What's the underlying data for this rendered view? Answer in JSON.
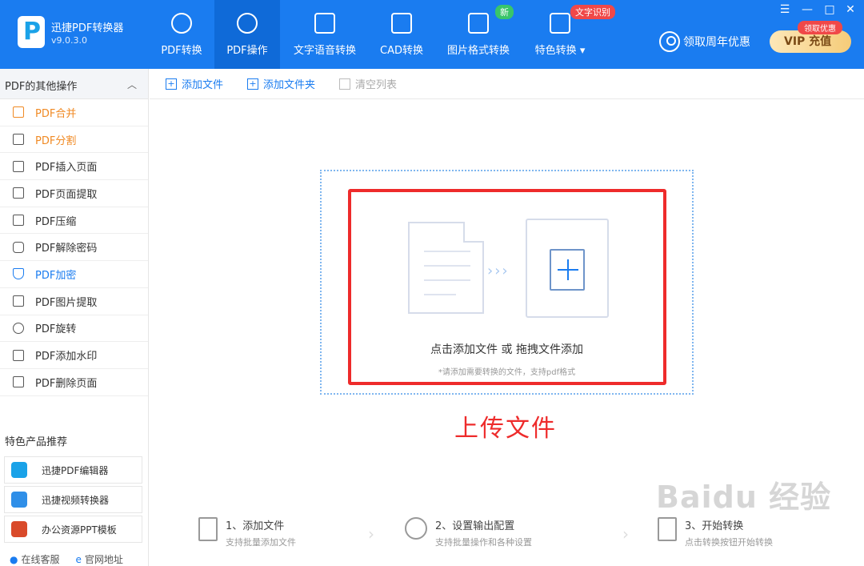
{
  "app": {
    "name": "迅捷PDF转换器",
    "version": "v9.0.3.0"
  },
  "nav": [
    {
      "label": "PDF转换"
    },
    {
      "label": "PDF操作"
    },
    {
      "label": "文字语音转换"
    },
    {
      "label": "CAD转换"
    },
    {
      "label": "图片格式转换"
    },
    {
      "label": "特色转换"
    }
  ],
  "badges": {
    "new": "新",
    "ocr": "文字识别"
  },
  "header": {
    "coupon": "领取周年优惠",
    "vip_tag": "领取优惠",
    "vip_label": "VIP 充值"
  },
  "window_controls": {
    "menu": "☰",
    "minimize": "—",
    "maximize": "□",
    "close": "✕"
  },
  "sidebar": {
    "title": "PDF的其他操作",
    "items": [
      {
        "label": "PDF合并",
        "icon": "merge-icon"
      },
      {
        "label": "PDF分割",
        "icon": "split-icon"
      },
      {
        "label": "PDF插入页面",
        "icon": "insert-page-icon"
      },
      {
        "label": "PDF页面提取",
        "icon": "extract-page-icon"
      },
      {
        "label": "PDF压缩",
        "icon": "compress-icon"
      },
      {
        "label": "PDF解除密码",
        "icon": "unlock-icon"
      },
      {
        "label": "PDF加密",
        "icon": "shield-icon"
      },
      {
        "label": "PDF图片提取",
        "icon": "image-icon"
      },
      {
        "label": "PDF旋转",
        "icon": "rotate-icon"
      },
      {
        "label": "PDF添加水印",
        "icon": "watermark-icon"
      },
      {
        "label": "PDF删除页面",
        "icon": "delete-page-icon"
      }
    ],
    "recommend_title": "特色产品推荐",
    "recommend": [
      {
        "label": "迅捷PDF编辑器",
        "color": "#1aa2e8"
      },
      {
        "label": "迅捷视频转换器",
        "color": "#2f8fe8"
      },
      {
        "label": "办公资源PPT模板",
        "color": "#d94a2a"
      }
    ],
    "footer": {
      "service": "在线客服",
      "website": "官网地址"
    }
  },
  "toolbar": {
    "add_file": "添加文件",
    "add_folder": "添加文件夹",
    "clear_list": "清空列表"
  },
  "dropzone": {
    "main": "点击添加文件 或 拖拽文件添加",
    "hint": "*请添加需要转换的文件，支持pdf格式",
    "arrows": "›››"
  },
  "annotation": "上传文件",
  "steps": [
    {
      "title": "1、添加文件",
      "sub": "支持批量添加文件"
    },
    {
      "title": "2、设置输出配置",
      "sub": "支持批量操作和各种设置"
    },
    {
      "title": "3、开始转换",
      "sub": "点击转换按钮开始转换"
    }
  ],
  "watermark": "Baidu 经验",
  "colors": {
    "primary": "#1a7cf0",
    "accent_red": "#ee2b2b",
    "active_orange": "#f08a24"
  }
}
